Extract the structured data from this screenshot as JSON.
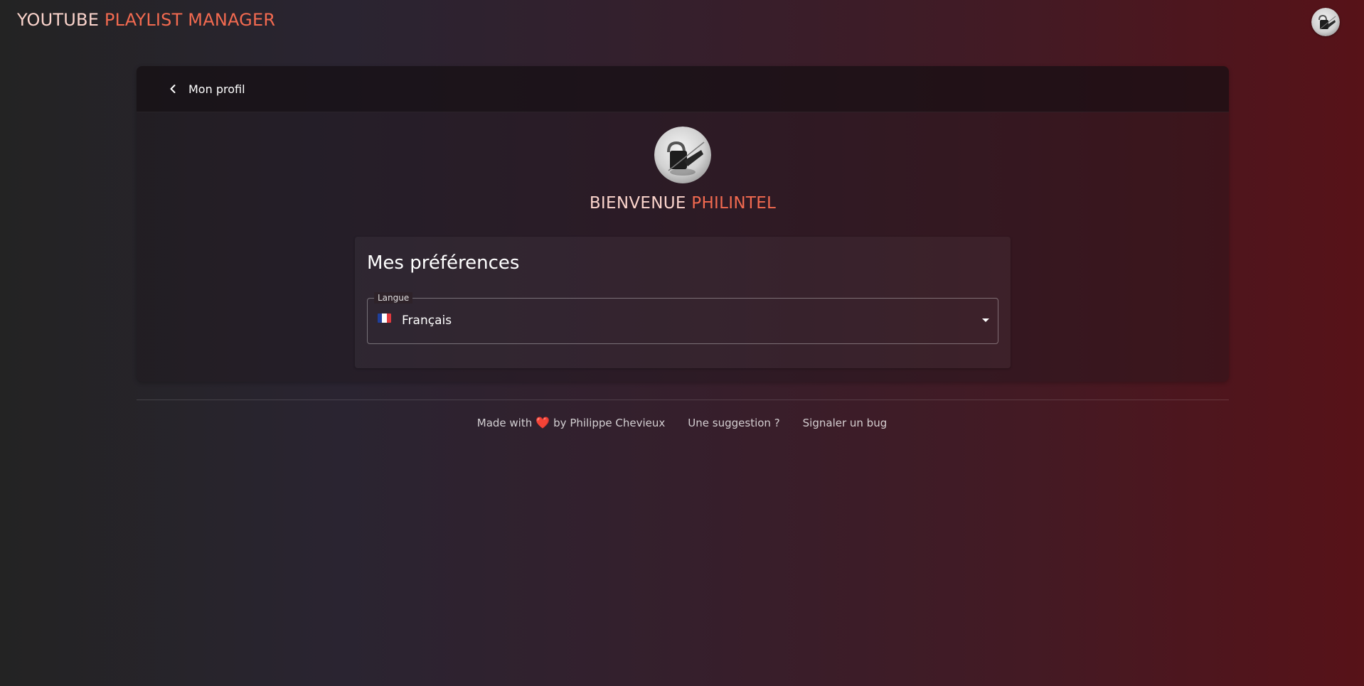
{
  "app": {
    "title_part1": "YOUTUBE",
    "title_part2": "PLAYLIST MANAGER"
  },
  "header": {
    "avatar_icon": "user-avatar-icon"
  },
  "profile": {
    "back_label": "Mon profil",
    "back_icon": "chevron-left-icon",
    "welcome_prefix": "BIENVENUE",
    "username": "PHILINTEL"
  },
  "preferences": {
    "title": "Mes préférences",
    "language_label": "Langue",
    "language_value": "Français",
    "language_flag": "flag-fr-icon"
  },
  "footer": {
    "credit_prefix": "Made with",
    "heart": "❤️",
    "credit_suffix": "by Philippe Chevieux",
    "suggestion_link": "Une suggestion ?",
    "bug_link": "Signaler un bug"
  },
  "colors": {
    "accent": "#f26a50",
    "title_light": "#fbd4cc",
    "background_left": "#232323",
    "background_right": "#571218"
  }
}
